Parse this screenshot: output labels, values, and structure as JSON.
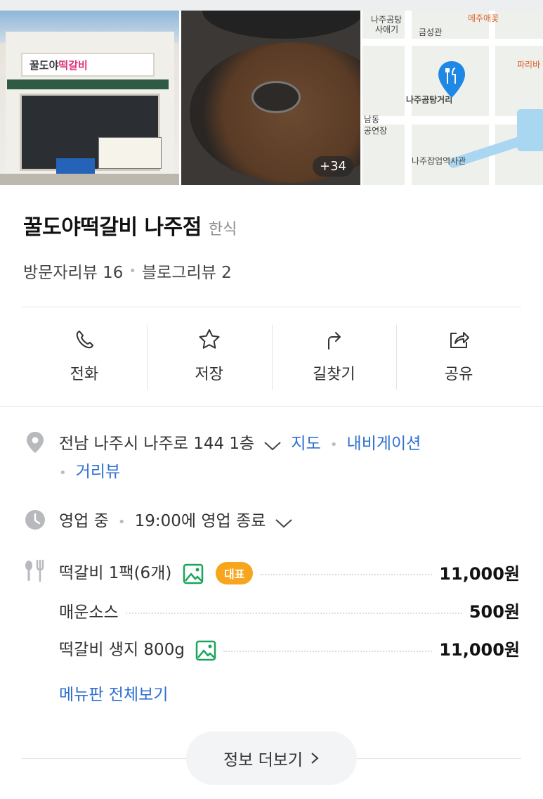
{
  "gallery": {
    "store_sign": {
      "prefix": "꿀도야",
      "highlight": "떡갈비"
    },
    "more_photos_badge": "+34",
    "map_labels": [
      "나주곰탕",
      "사애기",
      "금성관",
      "메주애꽃",
      "파리바",
      "나주곰탕거리",
      "남동",
      "공연장",
      "나주잡업역사관"
    ]
  },
  "place": {
    "name": "꿀도야떡갈비 나주점",
    "category": "한식",
    "visitor_reviews": "방문자리뷰 16",
    "blog_reviews": "블로그리뷰 2"
  },
  "actions": [
    {
      "label": "전화",
      "icon": "phone-icon"
    },
    {
      "label": "저장",
      "icon": "star-icon"
    },
    {
      "label": "길찾기",
      "icon": "directions-icon"
    },
    {
      "label": "공유",
      "icon": "share-icon"
    }
  ],
  "address": {
    "text": "전남 나주시 나주로 144 1층",
    "map_link": "지도",
    "nav_link": "내비게이션",
    "street_link": "거리뷰"
  },
  "hours": {
    "status": "영업 중",
    "close_text": "19:00에 영업 종료"
  },
  "menu": {
    "items": [
      {
        "name": "떡갈비 1팩(6개)",
        "price": "11,000원",
        "has_image": true,
        "badge": "대표"
      },
      {
        "name": "매운소스",
        "price": "500원",
        "has_image": false
      },
      {
        "name": "떡갈비 생지 800g",
        "price": "11,000원",
        "has_image": true
      }
    ],
    "view_all": "메뉴판 전체보기"
  },
  "more_info": "정보 더보기",
  "colors": {
    "link": "#2e6fd1",
    "badge": "#f7a51c",
    "pin": "#1e88e5"
  }
}
